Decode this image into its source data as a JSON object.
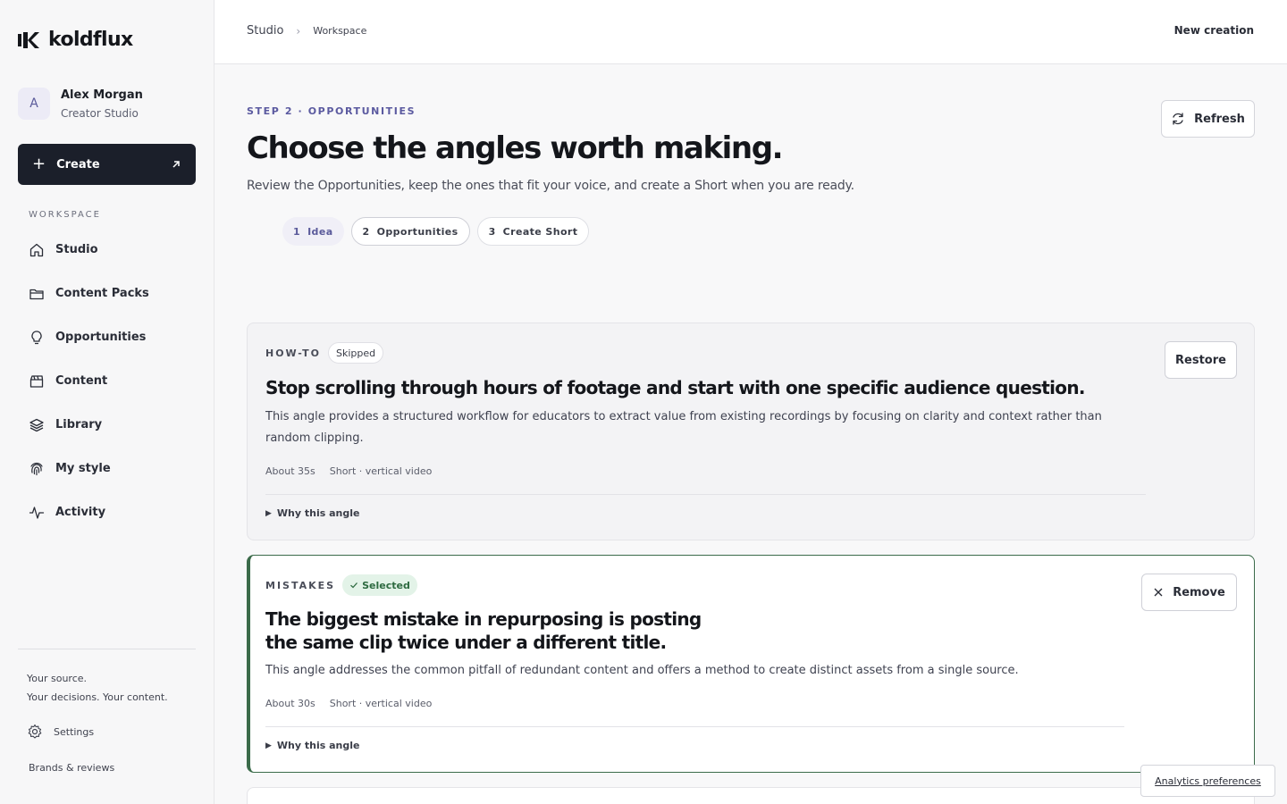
{
  "brand": {
    "name": "koldflux"
  },
  "user": {
    "initial": "A",
    "name": "Alex Morgan",
    "subtitle": "Creator Studio"
  },
  "sidebar": {
    "create_label": "Create",
    "section_label": "WORKSPACE",
    "items": [
      {
        "label": "Studio",
        "icon": "home-icon"
      },
      {
        "label": "Content Packs",
        "icon": "folder-icon"
      },
      {
        "label": "Opportunities",
        "icon": "lightbulb-icon"
      },
      {
        "label": "Content",
        "icon": "clapperboard-icon"
      },
      {
        "label": "Library",
        "icon": "layers-icon"
      },
      {
        "label": "My style",
        "icon": "fingerprint-icon"
      },
      {
        "label": "Activity",
        "icon": "activity-icon"
      }
    ],
    "tagline_1": "Your source.",
    "tagline_2": "Your decisions. Your content.",
    "settings_label": "Settings",
    "brands_label": "Brands & reviews"
  },
  "topbar": {
    "crumb_1": "Studio",
    "crumb_sep": "›",
    "crumb_2": "Workspace",
    "new_creation": "New creation"
  },
  "page": {
    "step_label": "STEP 2 · OPPORTUNITIES",
    "title": "Choose the angles worth making.",
    "subtitle": "Review the Opportunities, keep the ones that fit your voice, and create a Short when you are ready.",
    "refresh_label": "Refresh"
  },
  "steps": [
    {
      "num": "1",
      "label": "Idea"
    },
    {
      "num": "2",
      "label": "Opportunities"
    },
    {
      "num": "3",
      "label": "Create Short"
    }
  ],
  "cards": [
    {
      "category": "HOW-TO",
      "status": "Skipped",
      "title": "Stop scrolling through hours of footage and start with one specific audience question.",
      "description": "This angle provides a structured workflow for educators to extract value from existing recordings by focusing on clarity and context rather than random clipping.",
      "duration": "About 35s",
      "format": "Short · vertical video",
      "why": "Why this angle",
      "action": "Restore"
    },
    {
      "category": "MISTAKES",
      "status": "Selected",
      "title_line_1": "The biggest mistake in repurposing is posting",
      "title_line_2": "the same clip twice under a different title.",
      "description": "This angle addresses the common pitfall of redundant content and offers a method to create distinct assets from a single source.",
      "duration": "About 30s",
      "format": "Short · vertical video",
      "why": "Why this angle",
      "action": "Remove"
    }
  ],
  "analytics_label": "Analytics preferences"
}
